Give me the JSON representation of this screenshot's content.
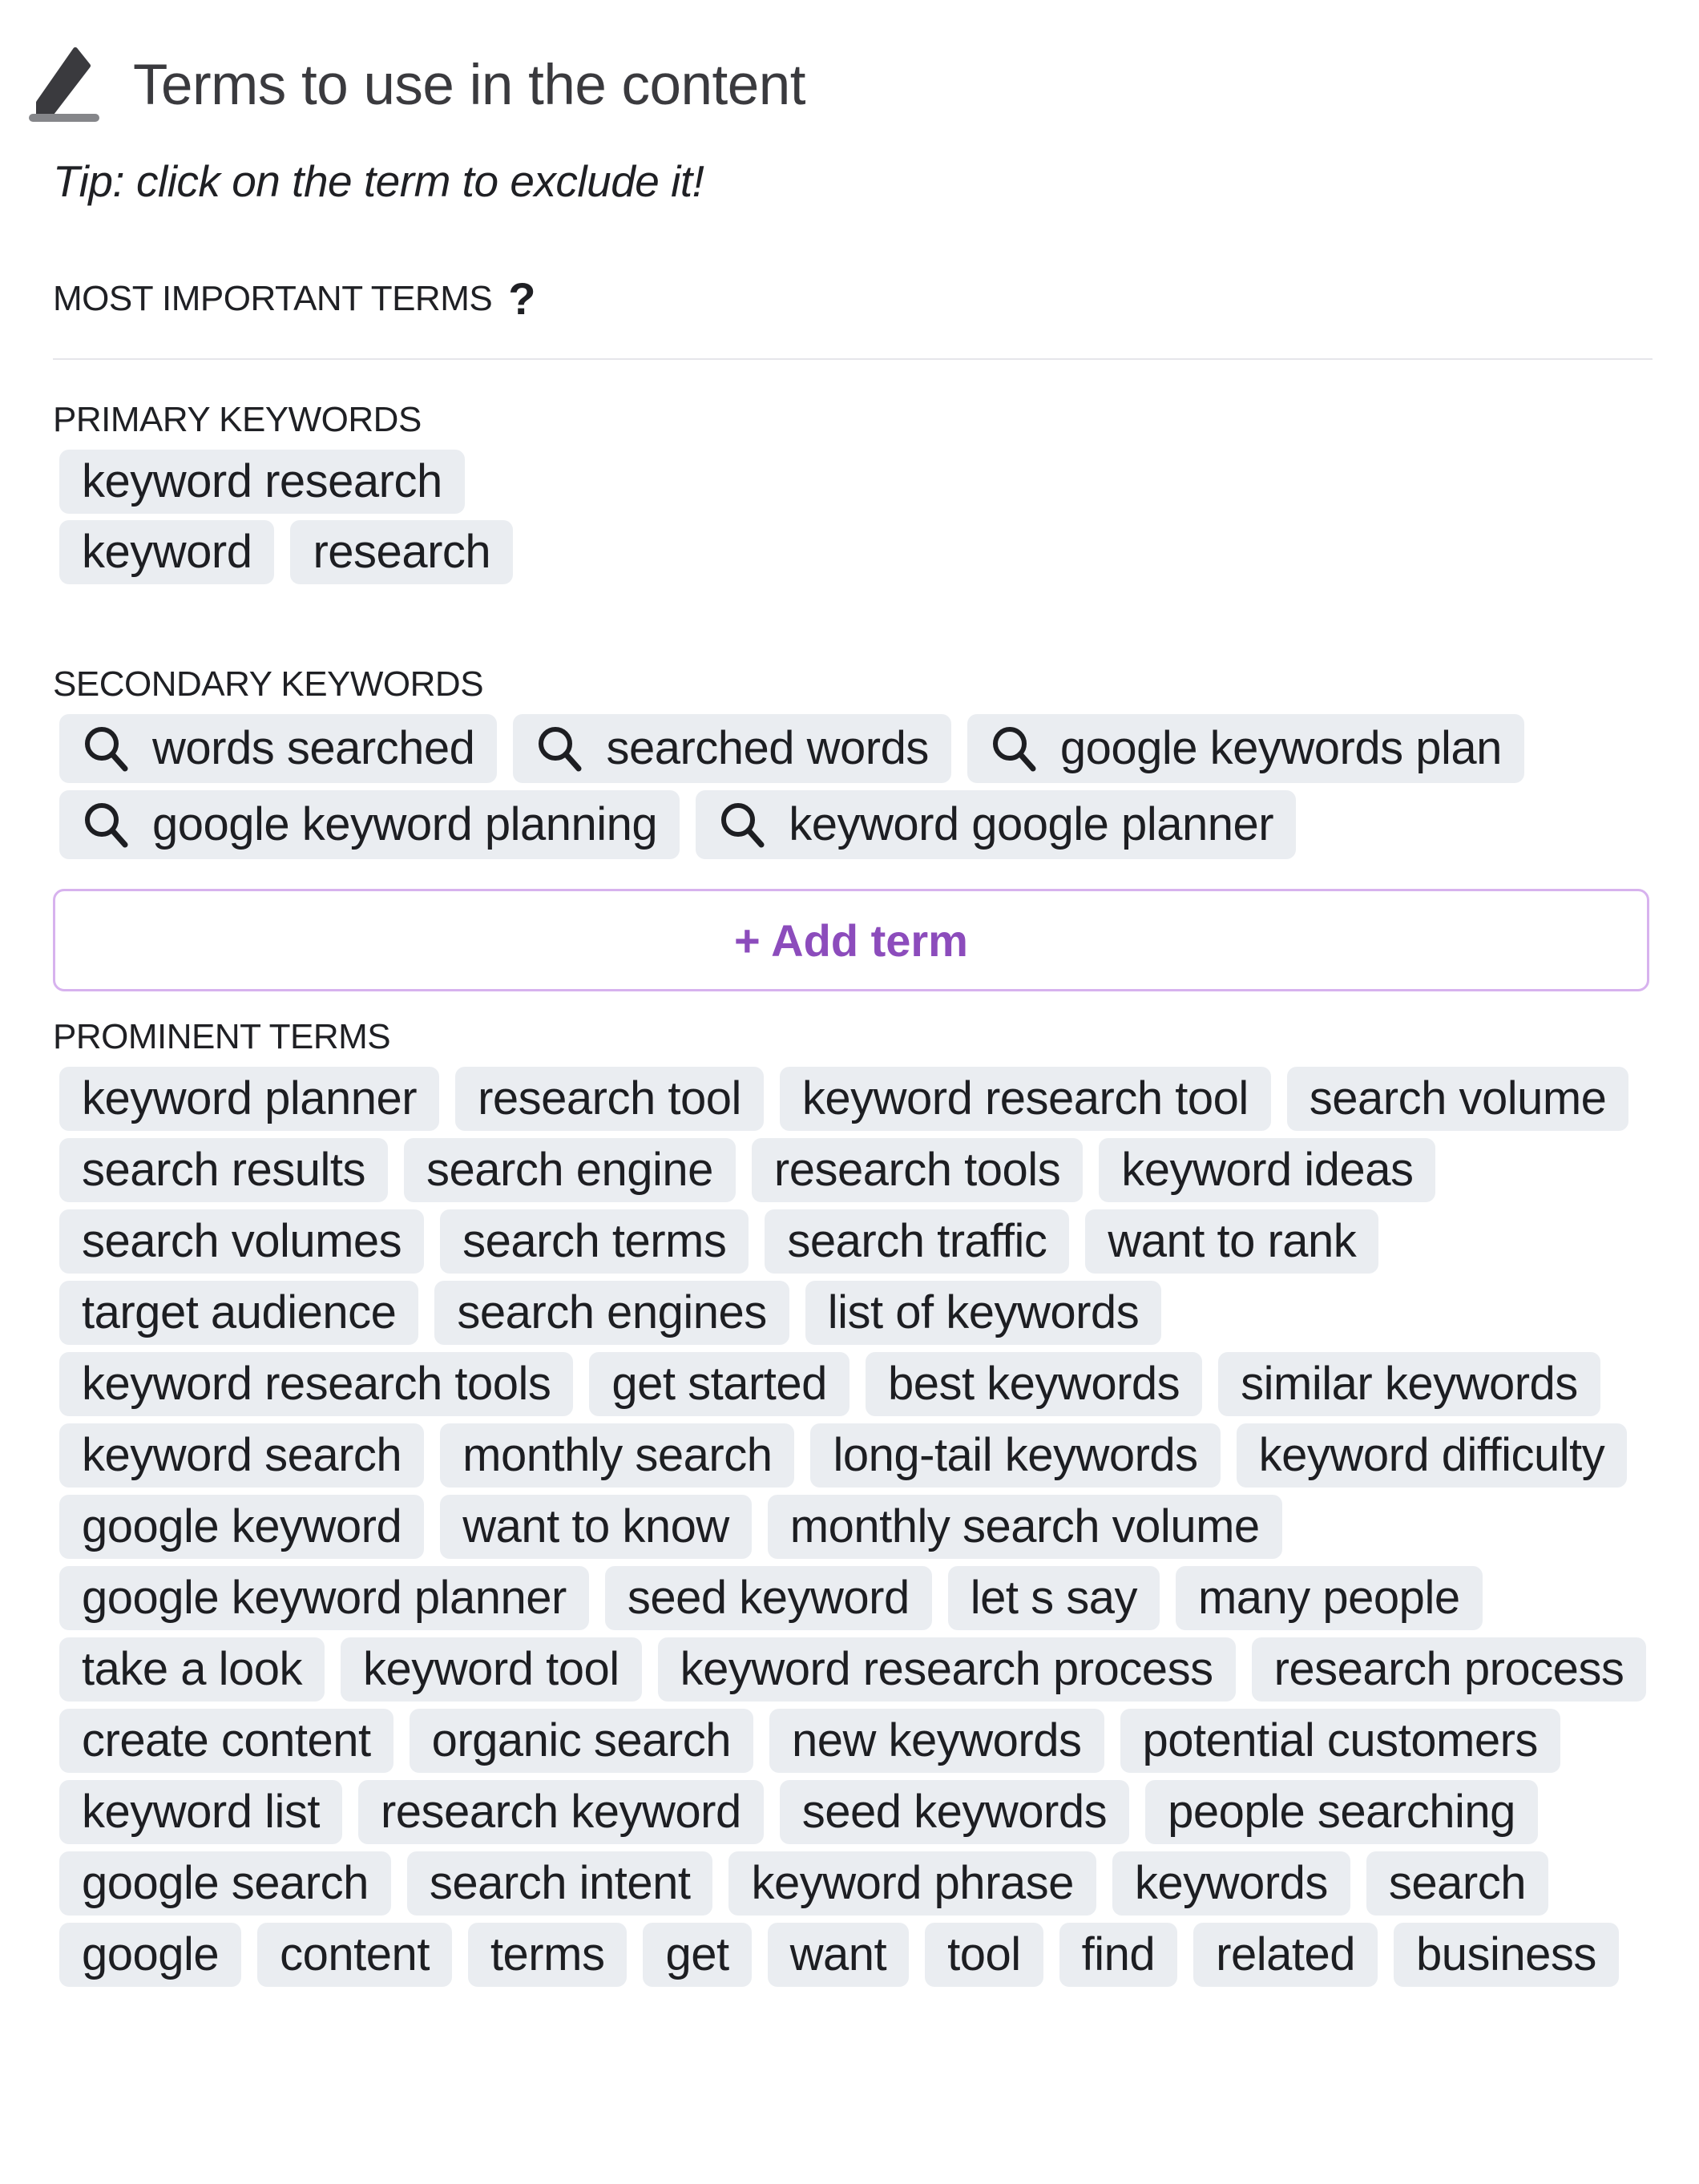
{
  "header": {
    "icon": "pencil-icon",
    "title": "Terms to use in the content"
  },
  "tip": "Tip: click on the term to exclude it!",
  "most_important": {
    "label": "MOST IMPORTANT TERMS",
    "help_icon": "?"
  },
  "primary": {
    "label": "PRIMARY KEYWORDS",
    "terms": [
      "keyword research",
      "keyword",
      "research"
    ]
  },
  "secondary": {
    "label": "SECONDARY KEYWORDS",
    "icon": "search-icon",
    "terms": [
      "words searched",
      "searched words",
      "google keywords plan",
      "google keyword planning",
      "keyword google planner"
    ]
  },
  "add_term": {
    "label": "+ Add term",
    "color": "#8c4cbc",
    "border_color": "#d7b2ee"
  },
  "prominent": {
    "label": "PROMINENT TERMS",
    "terms": [
      "keyword planner",
      "research tool",
      "keyword research tool",
      "search volume",
      "search results",
      "search engine",
      "research tools",
      "keyword ideas",
      "search volumes",
      "search terms",
      "search traffic",
      "want to rank",
      "target audience",
      "search engines",
      "list of keywords",
      "keyword research tools",
      "get started",
      "best keywords",
      "similar keywords",
      "keyword search",
      "monthly search",
      "long-tail keywords",
      "keyword difficulty",
      "google keyword",
      "want to know",
      "monthly search volume",
      "google keyword planner",
      "seed keyword",
      "let s say",
      "many people",
      "take a look",
      "keyword tool",
      "keyword research process",
      "research process",
      "create content",
      "organic search",
      "new keywords",
      "potential customers",
      "keyword list",
      "research keyword",
      "seed keywords",
      "people searching",
      "google search",
      "search intent",
      "keyword phrase",
      "keywords",
      "search",
      "google",
      "content",
      "terms",
      "get",
      "want",
      "tool",
      "find",
      "related",
      "business"
    ]
  },
  "colors": {
    "chip_bg": "#eaedf1",
    "text": "#1f2024"
  }
}
